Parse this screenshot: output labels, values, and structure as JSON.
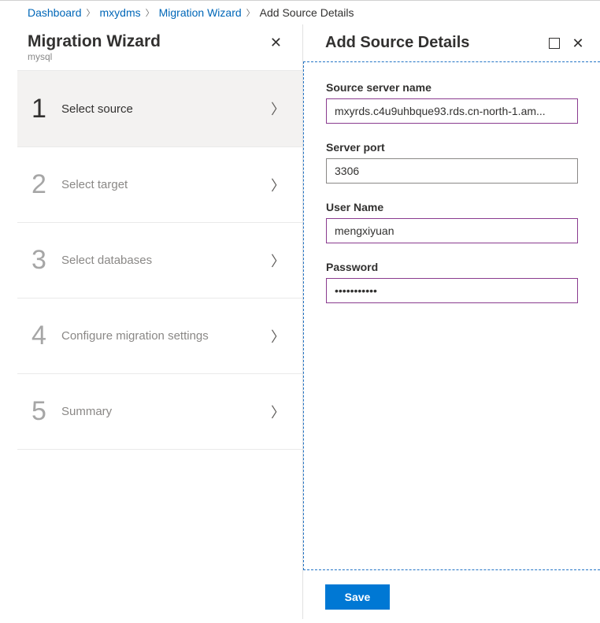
{
  "breadcrumb": {
    "items": [
      {
        "label": "Dashboard",
        "link": true
      },
      {
        "label": "mxydms",
        "link": true
      },
      {
        "label": "Migration Wizard",
        "link": true
      },
      {
        "label": "Add Source Details",
        "link": false
      }
    ]
  },
  "wizard": {
    "title": "Migration Wizard",
    "subtitle": "mysql",
    "steps": [
      {
        "num": "1",
        "label": "Select source",
        "active": true
      },
      {
        "num": "2",
        "label": "Select target",
        "active": false
      },
      {
        "num": "3",
        "label": "Select databases",
        "active": false
      },
      {
        "num": "4",
        "label": "Configure migration settings",
        "active": false
      },
      {
        "num": "5",
        "label": "Summary",
        "active": false
      }
    ]
  },
  "panel": {
    "title": "Add Source Details",
    "fields": {
      "server_name_label": "Source server name",
      "server_name_value": "mxyrds.c4u9uhbque93.rds.cn-north-1.am...",
      "server_port_label": "Server port",
      "server_port_value": "3306",
      "user_name_label": "User Name",
      "user_name_value": "mengxiyuan",
      "password_label": "Password",
      "password_value": "•••••••••••"
    },
    "save_label": "Save"
  }
}
